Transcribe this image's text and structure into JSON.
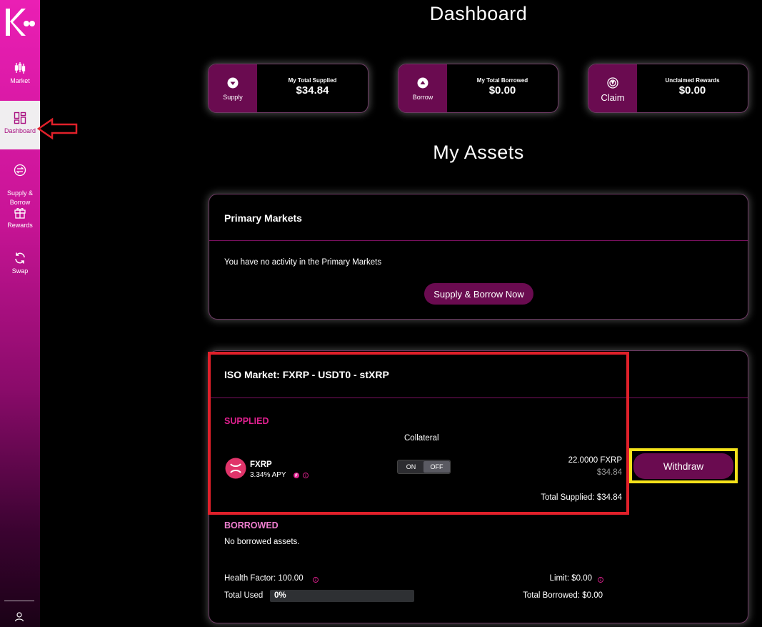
{
  "sidebar": {
    "items": [
      {
        "label": "Market",
        "icon": "candlestick-icon"
      },
      {
        "label": "Dashboard",
        "icon": "dashboard-icon"
      },
      {
        "label": "Supply &\nBorrow",
        "icon": "swap-arrows-icon"
      },
      {
        "label": "Rewards",
        "icon": "gift-icon"
      },
      {
        "label": "Swap",
        "icon": "refresh-icon"
      }
    ],
    "active": "Dashboard"
  },
  "header": {
    "title": "Dashboard"
  },
  "stats": [
    {
      "button_label": "Supply",
      "caption": "My Total Supplied",
      "value": "$34.84",
      "icon": "supply-icon"
    },
    {
      "button_label": "Borrow",
      "caption": "My Total Borrowed",
      "value": "$0.00",
      "icon": "borrow-icon"
    },
    {
      "button_label": "Claim",
      "caption": "Unclaimed Rewards",
      "value": "$0.00",
      "icon": "claim-icon"
    }
  ],
  "assets": {
    "title": "My Assets"
  },
  "primary_markets": {
    "title": "Primary Markets",
    "empty_text": "You have no activity in the Primary Markets",
    "cta_label": "Supply & Borrow Now"
  },
  "iso_market": {
    "title": "ISO Market: FXRP - USDT0 - stXRP",
    "supplied_label": "SUPPLIED",
    "collateral_label": "Collateral",
    "asset": {
      "symbol": "FXRP",
      "apy": "3.34% APY",
      "amount": "22.0000 FXRP",
      "usd": "$34.84"
    },
    "toggle": {
      "on": "ON",
      "off": "OFF",
      "state": "OFF"
    },
    "withdraw_label": "Withdraw",
    "total_supplied": "Total Supplied: $34.84",
    "borrowed_label": "BORROWED",
    "no_borrowed": "No borrowed assets.",
    "health_factor": "Health Factor: 100.00",
    "limit": "Limit: $0.00",
    "total_used_label": "Total Used",
    "total_used_value": "0%",
    "total_used_fraction": 0,
    "total_borrowed": "Total Borrowed: $0.00"
  },
  "colors": {
    "accent": "#6a0b50",
    "pink_label": "#e0208f",
    "borrowed_label": "#f07fd0",
    "annotation_red": "#e0202a",
    "annotation_yellow": "#f4e21a"
  }
}
